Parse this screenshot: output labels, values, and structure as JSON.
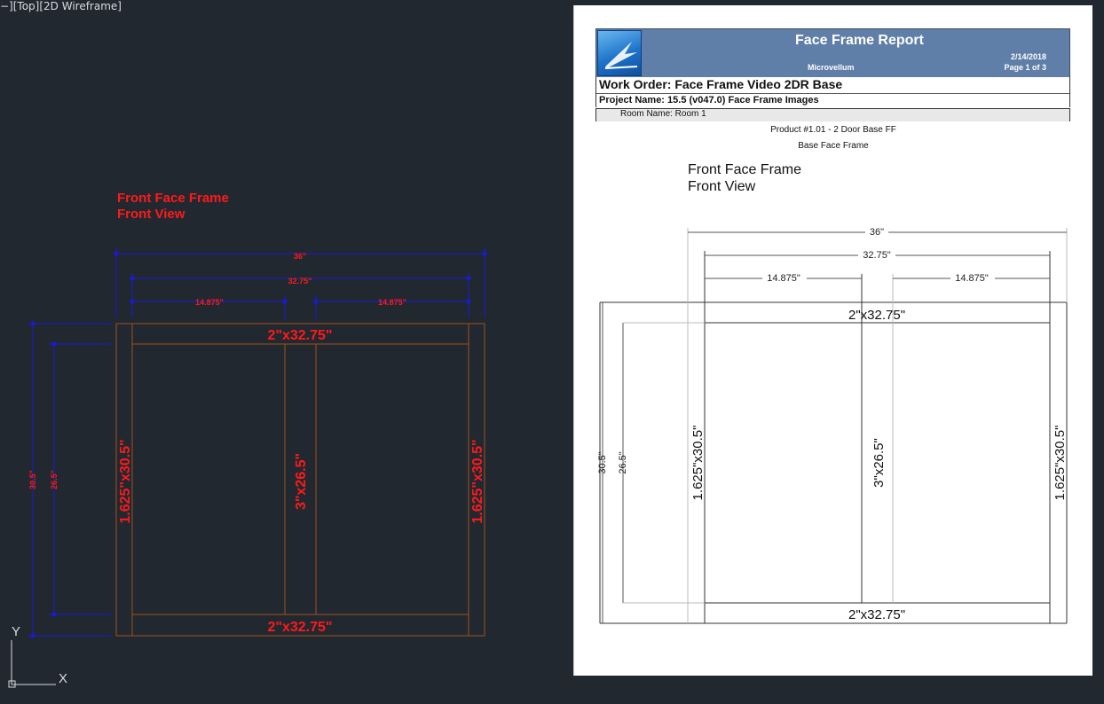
{
  "viewport": {
    "label": "−][Top][2D Wireframe]"
  },
  "cad": {
    "title_line1": "Front Face Frame",
    "title_line2": "Front View",
    "dims": {
      "overall_width": "36\"",
      "inner_width": "32.75\"",
      "left_opening": "14.875\"",
      "right_opening": "14.875\"",
      "overall_height": "30.5\"",
      "inner_height": "26.5\""
    },
    "parts": {
      "top_rail": "2\"x32.75\"",
      "bottom_rail": "2\"x32.75\"",
      "left_stile": "1.625\"x30.5\"",
      "right_stile": "1.625\"x30.5\"",
      "mid_stile": "3\"x26.5\""
    },
    "colors": {
      "dimension": "#1a1ad8",
      "label": "#ff1a1a",
      "part": "#a0521c"
    }
  },
  "ucs": {
    "y_label": "Y",
    "x_label": "X"
  },
  "report": {
    "title": "Face Frame Report",
    "company": "Microvellum",
    "date": "2/14/2018",
    "page": "Page 1 of 3",
    "work_order": "Work Order: Face Frame Video 2DR Base",
    "project_name": "Project Name: 15.5 (v047.0) Face Frame Images",
    "room_name": "Room Name: Room 1",
    "product": "Product #1.01 - 2 Door Base FF",
    "face_frame": "Base Face Frame",
    "drawing_title_1": "Front Face Frame",
    "drawing_title_2": "Front View",
    "dims": {
      "overall_width": "36\"",
      "inner_width": "32.75\"",
      "left_opening": "14.875\"",
      "right_opening": "14.875\"",
      "overall_height": "30.5\"",
      "inner_height": "26.5\""
    },
    "parts": {
      "top_rail": "2\"x32.75\"",
      "bottom_rail": "2\"x32.75\"",
      "left_stile": "1.625\"x30.5\"",
      "right_stile": "1.625\"x30.5\"",
      "mid_stile": "3\"x26.5\""
    },
    "colors": {
      "header": "#5f7ea8"
    }
  }
}
